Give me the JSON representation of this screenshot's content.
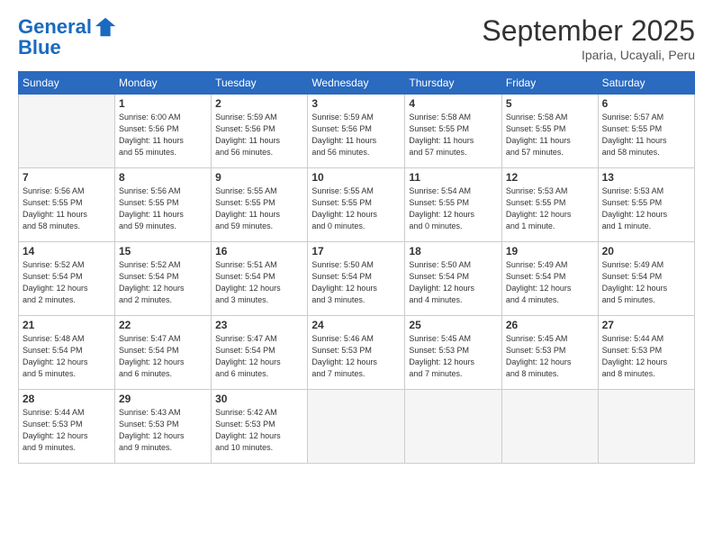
{
  "header": {
    "logo_line1": "General",
    "logo_line2": "Blue",
    "month": "September 2025",
    "location": "Iparia, Ucayali, Peru"
  },
  "columns": [
    "Sunday",
    "Monday",
    "Tuesday",
    "Wednesday",
    "Thursday",
    "Friday",
    "Saturday"
  ],
  "weeks": [
    [
      {
        "day": "",
        "info": ""
      },
      {
        "day": "1",
        "info": "Sunrise: 6:00 AM\nSunset: 5:56 PM\nDaylight: 11 hours\nand 55 minutes."
      },
      {
        "day": "2",
        "info": "Sunrise: 5:59 AM\nSunset: 5:56 PM\nDaylight: 11 hours\nand 56 minutes."
      },
      {
        "day": "3",
        "info": "Sunrise: 5:59 AM\nSunset: 5:56 PM\nDaylight: 11 hours\nand 56 minutes."
      },
      {
        "day": "4",
        "info": "Sunrise: 5:58 AM\nSunset: 5:55 PM\nDaylight: 11 hours\nand 57 minutes."
      },
      {
        "day": "5",
        "info": "Sunrise: 5:58 AM\nSunset: 5:55 PM\nDaylight: 11 hours\nand 57 minutes."
      },
      {
        "day": "6",
        "info": "Sunrise: 5:57 AM\nSunset: 5:55 PM\nDaylight: 11 hours\nand 58 minutes."
      }
    ],
    [
      {
        "day": "7",
        "info": "Sunrise: 5:56 AM\nSunset: 5:55 PM\nDaylight: 11 hours\nand 58 minutes."
      },
      {
        "day": "8",
        "info": "Sunrise: 5:56 AM\nSunset: 5:55 PM\nDaylight: 11 hours\nand 59 minutes."
      },
      {
        "day": "9",
        "info": "Sunrise: 5:55 AM\nSunset: 5:55 PM\nDaylight: 11 hours\nand 59 minutes."
      },
      {
        "day": "10",
        "info": "Sunrise: 5:55 AM\nSunset: 5:55 PM\nDaylight: 12 hours\nand 0 minutes."
      },
      {
        "day": "11",
        "info": "Sunrise: 5:54 AM\nSunset: 5:55 PM\nDaylight: 12 hours\nand 0 minutes."
      },
      {
        "day": "12",
        "info": "Sunrise: 5:53 AM\nSunset: 5:55 PM\nDaylight: 12 hours\nand 1 minute."
      },
      {
        "day": "13",
        "info": "Sunrise: 5:53 AM\nSunset: 5:55 PM\nDaylight: 12 hours\nand 1 minute."
      }
    ],
    [
      {
        "day": "14",
        "info": "Sunrise: 5:52 AM\nSunset: 5:54 PM\nDaylight: 12 hours\nand 2 minutes."
      },
      {
        "day": "15",
        "info": "Sunrise: 5:52 AM\nSunset: 5:54 PM\nDaylight: 12 hours\nand 2 minutes."
      },
      {
        "day": "16",
        "info": "Sunrise: 5:51 AM\nSunset: 5:54 PM\nDaylight: 12 hours\nand 3 minutes."
      },
      {
        "day": "17",
        "info": "Sunrise: 5:50 AM\nSunset: 5:54 PM\nDaylight: 12 hours\nand 3 minutes."
      },
      {
        "day": "18",
        "info": "Sunrise: 5:50 AM\nSunset: 5:54 PM\nDaylight: 12 hours\nand 4 minutes."
      },
      {
        "day": "19",
        "info": "Sunrise: 5:49 AM\nSunset: 5:54 PM\nDaylight: 12 hours\nand 4 minutes."
      },
      {
        "day": "20",
        "info": "Sunrise: 5:49 AM\nSunset: 5:54 PM\nDaylight: 12 hours\nand 5 minutes."
      }
    ],
    [
      {
        "day": "21",
        "info": "Sunrise: 5:48 AM\nSunset: 5:54 PM\nDaylight: 12 hours\nand 5 minutes."
      },
      {
        "day": "22",
        "info": "Sunrise: 5:47 AM\nSunset: 5:54 PM\nDaylight: 12 hours\nand 6 minutes."
      },
      {
        "day": "23",
        "info": "Sunrise: 5:47 AM\nSunset: 5:54 PM\nDaylight: 12 hours\nand 6 minutes."
      },
      {
        "day": "24",
        "info": "Sunrise: 5:46 AM\nSunset: 5:53 PM\nDaylight: 12 hours\nand 7 minutes."
      },
      {
        "day": "25",
        "info": "Sunrise: 5:45 AM\nSunset: 5:53 PM\nDaylight: 12 hours\nand 7 minutes."
      },
      {
        "day": "26",
        "info": "Sunrise: 5:45 AM\nSunset: 5:53 PM\nDaylight: 12 hours\nand 8 minutes."
      },
      {
        "day": "27",
        "info": "Sunrise: 5:44 AM\nSunset: 5:53 PM\nDaylight: 12 hours\nand 8 minutes."
      }
    ],
    [
      {
        "day": "28",
        "info": "Sunrise: 5:44 AM\nSunset: 5:53 PM\nDaylight: 12 hours\nand 9 minutes."
      },
      {
        "day": "29",
        "info": "Sunrise: 5:43 AM\nSunset: 5:53 PM\nDaylight: 12 hours\nand 9 minutes."
      },
      {
        "day": "30",
        "info": "Sunrise: 5:42 AM\nSunset: 5:53 PM\nDaylight: 12 hours\nand 10 minutes."
      },
      {
        "day": "",
        "info": ""
      },
      {
        "day": "",
        "info": ""
      },
      {
        "day": "",
        "info": ""
      },
      {
        "day": "",
        "info": ""
      }
    ]
  ]
}
